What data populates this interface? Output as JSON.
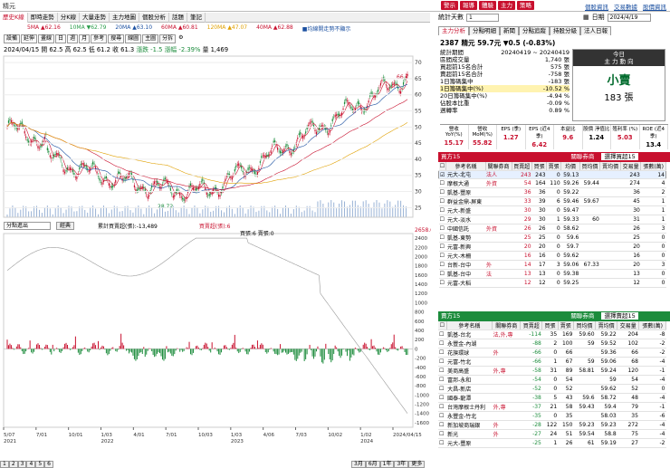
{
  "app": {
    "title": "精元"
  },
  "top_buttons": [
    "警示",
    "報導",
    "體驗",
    "主力",
    "策略"
  ],
  "top_links": [
    "個股資訊",
    "交易數據",
    "股價資訊"
  ],
  "left_tabs": [
    "歷史K線",
    "即時走勢",
    "分K線",
    "大量走勢",
    "主力地圖",
    "個股分析",
    "話題",
    "筆記"
  ],
  "ma_legend": [
    {
      "label": "5MA ▲62.16",
      "color": "#c8102e"
    },
    {
      "label": "10MA ▼62.79",
      "color": "#2a9d4a"
    },
    {
      "label": "20MA ▲63.10",
      "color": "#1a4fa0"
    },
    {
      "label": "60MA ▲60.81",
      "color": "#c8102e"
    },
    {
      "label": "120MA ▲47.07",
      "color": "#e0a000"
    },
    {
      "label": "40MA ▲62.88",
      "color": "#c8102e"
    },
    {
      "label": "■均線開走勢不顯示",
      "color": "#1a4fa0"
    }
  ],
  "tools": [
    "設備",
    "延伸",
    "畫線",
    "日",
    "週",
    "月",
    "參考",
    "搜尋",
    "線圖",
    "主圖",
    "分拆"
  ],
  "price_info": {
    "date": "2024/04/15",
    "open": "開 62.5",
    "high": "高 62.5",
    "low": "低 61.2",
    "close": "收 61.3",
    "change": "漲跌 -1.5",
    "pct": "漲幅 -2.39%",
    "vol": "量 1,469"
  },
  "chart": {
    "y_ticks": [
      "70",
      "65",
      "60",
      "55",
      "50",
      "45",
      "40",
      "35",
      "30",
      "25"
    ],
    "hi_label": "66.7",
    "lo_label": "28.72",
    "x_labels": [
      "5/07\n2021",
      "7/01",
      "10/01",
      "1/03\n2022",
      "4/01",
      "7/01",
      "10/03",
      "1/03\n2023",
      "4/06",
      "7/03",
      "10/02",
      "1/02\n2024",
      "2024/04/15"
    ],
    "indicator_select": "分點進出",
    "indicator_btn": "經典",
    "indicator_legend": "累計買賣超(張):-13,489",
    "indicator_legend2": "買賣超(張):6",
    "indicator_sub": "買張:6 賣張:0",
    "sub_top": "2658.6",
    "sub_ticks": [
      "2400",
      "2200",
      "2000",
      "1800",
      "1600",
      "1400",
      "1200",
      "1000",
      "800",
      "600",
      "400",
      "200",
      "0",
      "-200",
      "-400",
      "-600",
      "-800",
      "-1000",
      "-1200",
      "-1400",
      "-1600"
    ]
  },
  "bottom_tabs": [
    "1",
    "2",
    "3",
    "4",
    "5",
    "6"
  ],
  "time_buttons": [
    "3月",
    "6月",
    "1年",
    "3年",
    "更多"
  ],
  "right": {
    "stat_label": "統計天數",
    "stat_value": "1",
    "date_label": "日期",
    "date_value": "2024/4/19",
    "tabs": [
      "主力分析",
      "分點明細",
      "新聞",
      "分點追蹤",
      "持股分級",
      "法人日報"
    ],
    "stock_head": "2387 精元  59.7元 ▼0.5 (-0.83%)",
    "info_rows": [
      {
        "k": "統計期間",
        "v": "20240419 ~ 20240419",
        "hl": false
      },
      {
        "k": "區間成交量",
        "v": "1,740 張",
        "hl": false
      },
      {
        "k": "買超前15名合計",
        "v": "575 張",
        "hl": false
      },
      {
        "k": "賣超前15名合計",
        "v": "-758 張",
        "hl": false
      },
      {
        "k": "1日籌碼集中",
        "v": "-183 張",
        "hl": false
      },
      {
        "k": "1日籌碼集中(%)",
        "v": "-10.52 %",
        "hl": true
      },
      {
        "k": "20日籌碼集中(%)",
        "v": "-4.94 %",
        "hl": false
      },
      {
        "k": "佔股本比重",
        "v": "-0.09 %",
        "hl": false
      },
      {
        "k": "週轉率",
        "v": "0.89 %",
        "hl": false
      }
    ],
    "trend": {
      "h1": "今日",
      "h2": "主 力 動 向",
      "value": "小賣",
      "num": "183 張"
    },
    "stats": [
      {
        "k": "營收\nYoY(%)",
        "v": "15.17",
        "red": true
      },
      {
        "k": "營收\nMoM(%)",
        "v": "55.82",
        "red": true
      },
      {
        "k": "EPS\n(季)",
        "v": "1.27",
        "red": true
      },
      {
        "k": "EPS\n(近4季)",
        "v": "6.42",
        "red": true
      },
      {
        "k": "本益比",
        "v": "9.6",
        "red": true
      },
      {
        "k": "股價\n淨值比",
        "v": "1.24",
        "red": false
      },
      {
        "k": "殖利率\n(%)",
        "v": "5.03",
        "red": true
      },
      {
        "k": "ROE\n(近4季)",
        "v": "13.4",
        "red": false
      }
    ],
    "buy_title": "買方15",
    "buy_toggle": "關聯券商",
    "buy_select": "選擇買超15",
    "cols": [
      "參考名稱",
      "關聯券商",
      "買賣超",
      "買張",
      "賣張",
      "均價",
      "買均價",
      "賣均價",
      "交易量",
      "張數(萬)"
    ],
    "buy_rows": [
      [
        "元大-北屯",
        "法人",
        "243",
        "243",
        "0",
        "59.13",
        "",
        "",
        "243",
        "14"
      ],
      [
        "摩根大通",
        "外資",
        "54",
        "164",
        "110",
        "59.26",
        "59.44",
        "",
        "274",
        "4"
      ],
      [
        "凱基-豐原",
        "",
        "36",
        "36",
        "0",
        "59.22",
        "",
        "",
        "36",
        "2"
      ],
      [
        "群益金鼎-屏東",
        "",
        "33",
        "39",
        "6",
        "59.46",
        "59.67",
        "",
        "45",
        "1"
      ],
      [
        "元大-新盛",
        "",
        "30",
        "30",
        "0",
        "59.47",
        "",
        "",
        "30",
        "1"
      ],
      [
        "元大-淡水",
        "",
        "29",
        "30",
        "1",
        "59.33",
        "60",
        "",
        "31",
        "1"
      ],
      [
        "中國信託",
        "外資",
        "26",
        "26",
        "0",
        "58.62",
        "",
        "",
        "26",
        "3"
      ],
      [
        "凱基-東勢",
        "",
        "25",
        "25",
        "0",
        "59.6",
        "",
        "",
        "25",
        "0"
      ],
      [
        "元富-新興",
        "",
        "20",
        "20",
        "0",
        "59.7",
        "",
        "",
        "20",
        "0"
      ],
      [
        "元大-木柵",
        "",
        "16",
        "16",
        "0",
        "59.62",
        "",
        "",
        "16",
        "0"
      ],
      [
        "台新-台中",
        "外",
        "14",
        "17",
        "3",
        "59.06",
        "67.33",
        "",
        "20",
        "3"
      ],
      [
        "凱基-台中",
        "法",
        "13",
        "13",
        "0",
        "59.38",
        "",
        "",
        "13",
        "0"
      ],
      [
        "元富-大稻",
        "",
        "12",
        "12",
        "0",
        "59.25",
        "",
        "",
        "12",
        "0"
      ]
    ],
    "sell_title": "賣方15",
    "sell_toggle": "關聯券商",
    "sell_select": "選擇賣超15",
    "sell_rows": [
      [
        "凱基-台北",
        "法,外,專",
        "-114",
        "35",
        "169",
        "59.60",
        "59.22",
        "204",
        "-8"
      ],
      [
        "永豐金-內湖",
        "",
        "-88",
        "2",
        "100",
        "59",
        "59.52",
        "102",
        "-2"
      ],
      [
        "花旗環球",
        "外",
        "-66",
        "0",
        "66",
        "",
        "59.36",
        "66",
        "-2"
      ],
      [
        "元富-竹北",
        "",
        "-66",
        "1",
        "67",
        "59",
        "59.06",
        "68",
        "-4"
      ],
      [
        "美商高盛",
        "外,專",
        "-58",
        "31",
        "89",
        "58.81",
        "59.24",
        "120",
        "-1"
      ],
      [
        "富邦-永和",
        "",
        "-54",
        "0",
        "54",
        "",
        "59",
        "54",
        "-4"
      ],
      [
        "大昌-新店",
        "",
        "-52",
        "0",
        "52",
        "",
        "59.62",
        "52",
        "0"
      ],
      [
        "國泰-龍潭",
        "",
        "-38",
        "5",
        "43",
        "59.6",
        "58.72",
        "48",
        "-4"
      ],
      [
        "台灣摩根士丹利",
        "外,專",
        "-37",
        "21",
        "58",
        "59.43",
        "59.4",
        "79",
        "-1"
      ],
      [
        "永豐金-竹北",
        "",
        "-35",
        "0",
        "35",
        "",
        "58.03",
        "35",
        "-6"
      ],
      [
        "新加坡商瑞銀",
        "外",
        "-28",
        "122",
        "150",
        "59.23",
        "59.23",
        "272",
        "-4"
      ],
      [
        "新光",
        "外",
        "-27",
        "24",
        "51",
        "59.54",
        "58.8",
        "75",
        "-4"
      ],
      [
        "元大-豐原",
        "",
        "-25",
        "1",
        "26",
        "61",
        "59.19",
        "27",
        "-2"
      ]
    ]
  }
}
